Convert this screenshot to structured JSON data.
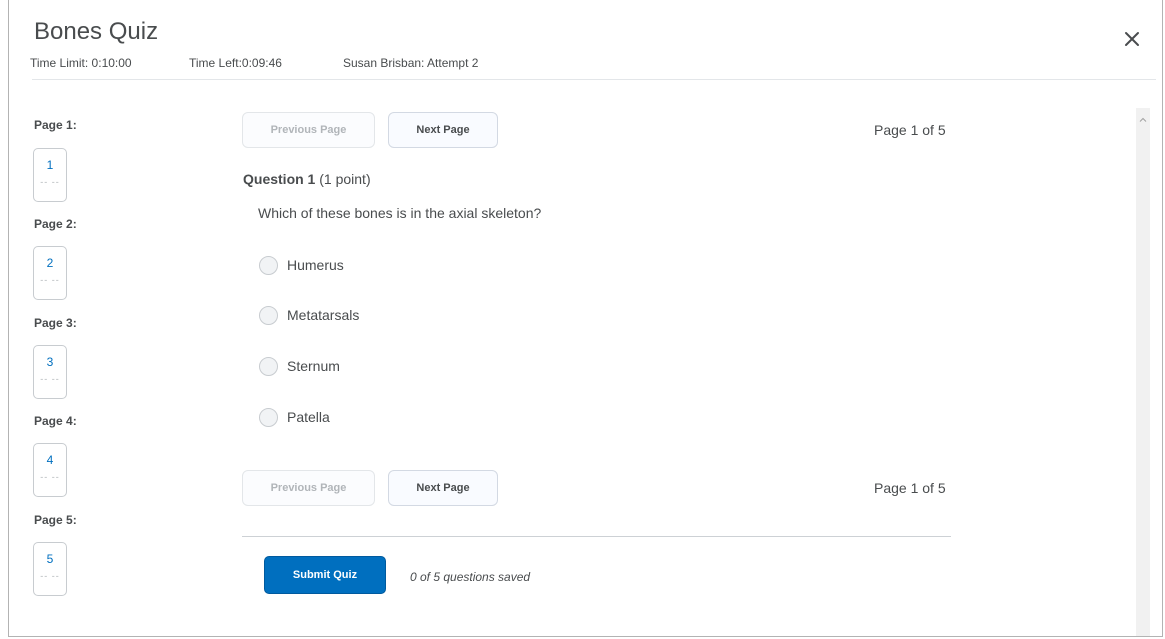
{
  "header": {
    "title": "Bones Quiz",
    "time_limit": "Time Limit: 0:10:00",
    "time_left": "Time Left:0:09:46",
    "attempt": "Susan Brisban: Attempt 2"
  },
  "nav": {
    "pages": [
      {
        "label": "Page 1:",
        "number": "1",
        "status": "-- --"
      },
      {
        "label": "Page 2:",
        "number": "2",
        "status": "-- --"
      },
      {
        "label": "Page 3:",
        "number": "3",
        "status": "-- --"
      },
      {
        "label": "Page 4:",
        "number": "4",
        "status": "-- --"
      },
      {
        "label": "Page 5:",
        "number": "5",
        "status": "-- --"
      }
    ]
  },
  "pager": {
    "previous_label": "Previous Page",
    "next_label": "Next Page",
    "page_indicator": "Page 1 of 5"
  },
  "question": {
    "title": "Question 1",
    "points": "(1 point)",
    "text": "Which of these bones is in the axial skeleton?",
    "options": [
      "Humerus",
      "Metatarsals",
      "Sternum",
      "Patella"
    ]
  },
  "footer": {
    "submit_label": "Submit Quiz",
    "saved_status": "0 of 5 questions saved"
  }
}
